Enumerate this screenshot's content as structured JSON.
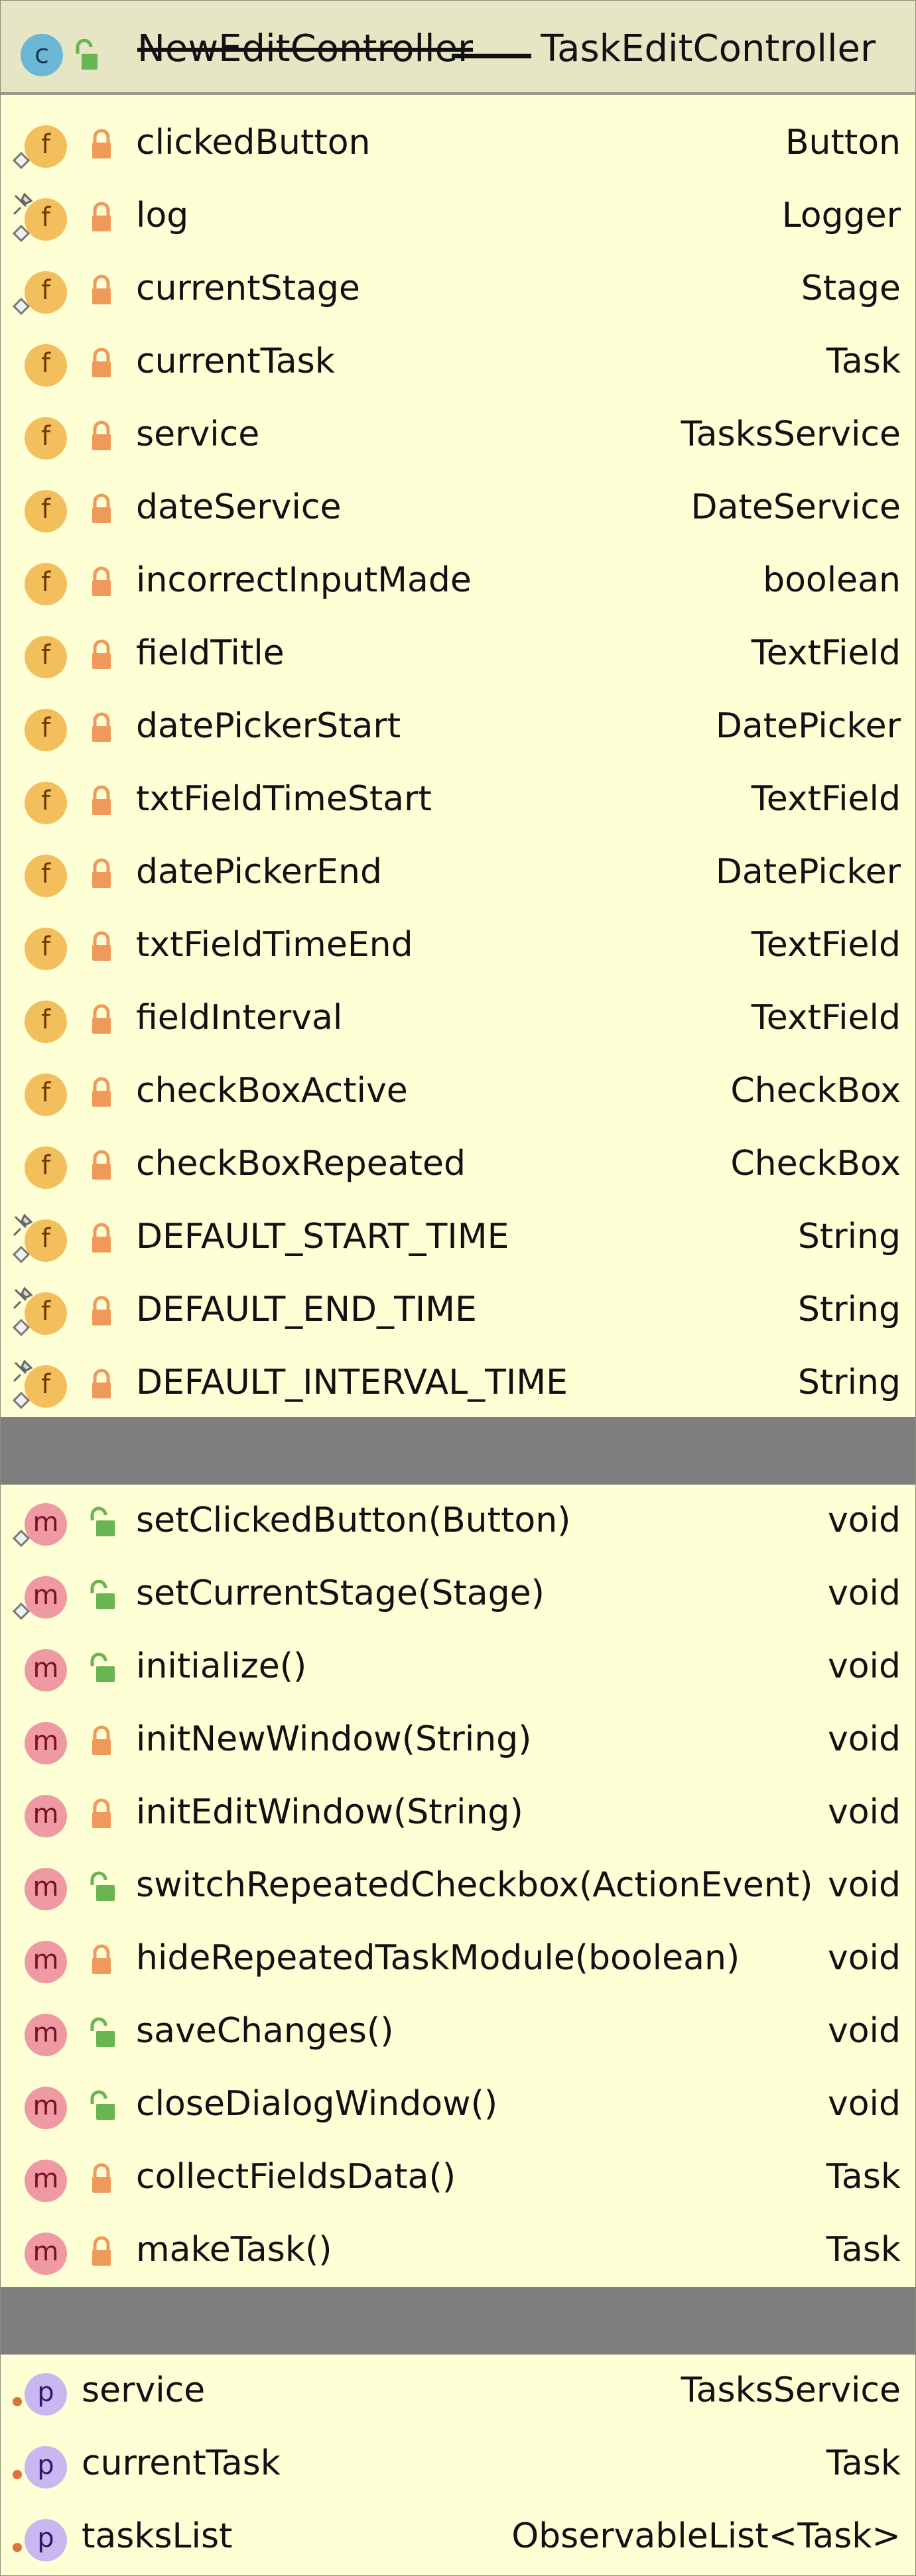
{
  "header": {
    "old_name": "NewEditController",
    "class_name": "TaskEditController",
    "class_icon_letter": "c",
    "icon_color": "#6ab7d6"
  },
  "fields": [
    {
      "name": "clickedButton",
      "type": "Button",
      "icon": "field-icon",
      "lock": "locked",
      "marker": "diamond"
    },
    {
      "name": "log",
      "type": "Logger",
      "icon": "field-icon",
      "lock": "locked",
      "marker": "pin-diamond"
    },
    {
      "name": "currentStage",
      "type": "Stage",
      "icon": "field-icon",
      "lock": "locked",
      "marker": "diamond"
    },
    {
      "name": "currentTask",
      "type": "Task",
      "icon": "field-icon",
      "lock": "locked",
      "marker": ""
    },
    {
      "name": "service",
      "type": "TasksService",
      "icon": "field-icon",
      "lock": "locked",
      "marker": ""
    },
    {
      "name": "dateService",
      "type": "DateService",
      "icon": "field-icon",
      "lock": "locked",
      "marker": ""
    },
    {
      "name": "incorrectInputMade",
      "type": "boolean",
      "icon": "field-icon",
      "lock": "locked",
      "marker": ""
    },
    {
      "name": "fieldTitle",
      "type": "TextField",
      "icon": "field-icon",
      "lock": "locked",
      "marker": ""
    },
    {
      "name": "datePickerStart",
      "type": "DatePicker",
      "icon": "field-icon",
      "lock": "locked",
      "marker": ""
    },
    {
      "name": "txtFieldTimeStart",
      "type": "TextField",
      "icon": "field-icon",
      "lock": "locked",
      "marker": ""
    },
    {
      "name": "datePickerEnd",
      "type": "DatePicker",
      "icon": "field-icon",
      "lock": "locked",
      "marker": ""
    },
    {
      "name": "txtFieldTimeEnd",
      "type": "TextField",
      "icon": "field-icon",
      "lock": "locked",
      "marker": ""
    },
    {
      "name": "fieldInterval",
      "type": "TextField",
      "icon": "field-icon",
      "lock": "locked",
      "marker": ""
    },
    {
      "name": "checkBoxActive",
      "type": "CheckBox",
      "icon": "field-icon",
      "lock": "locked",
      "marker": ""
    },
    {
      "name": "checkBoxRepeated",
      "type": "CheckBox",
      "icon": "field-icon",
      "lock": "locked",
      "marker": ""
    },
    {
      "name": "DEFAULT_START_TIME",
      "type": "String",
      "icon": "field-icon",
      "lock": "locked",
      "marker": "pin-diamond"
    },
    {
      "name": "DEFAULT_END_TIME",
      "type": "String",
      "icon": "field-icon",
      "lock": "locked",
      "marker": "pin-diamond"
    },
    {
      "name": "DEFAULT_INTERVAL_TIME",
      "type": "String",
      "icon": "field-icon",
      "lock": "locked",
      "marker": "pin-diamond"
    }
  ],
  "methods": [
    {
      "name": "setClickedButton(Button)",
      "type": "void",
      "lock": "unlocked",
      "marker": "diamond"
    },
    {
      "name": "setCurrentStage(Stage)",
      "type": "void",
      "lock": "unlocked",
      "marker": "diamond"
    },
    {
      "name": "initialize()",
      "type": "void",
      "lock": "unlocked",
      "marker": ""
    },
    {
      "name": "initNewWindow(String)",
      "type": "void",
      "lock": "locked",
      "marker": ""
    },
    {
      "name": "initEditWindow(String)",
      "type": "void",
      "lock": "locked",
      "marker": ""
    },
    {
      "name": "switchRepeatedCheckbox(ActionEvent)",
      "type": "void",
      "lock": "unlocked",
      "marker": ""
    },
    {
      "name": "hideRepeatedTaskModule(boolean)",
      "type": "void",
      "lock": "locked",
      "marker": ""
    },
    {
      "name": "saveChanges()",
      "type": "void",
      "lock": "unlocked",
      "marker": ""
    },
    {
      "name": "closeDialogWindow()",
      "type": "void",
      "lock": "unlocked",
      "marker": ""
    },
    {
      "name": "collectFieldsData()",
      "type": "Task",
      "lock": "locked",
      "marker": ""
    },
    {
      "name": "makeTask()",
      "type": "Task",
      "lock": "locked",
      "marker": ""
    }
  ],
  "properties": [
    {
      "name": "service",
      "type": "TasksService"
    },
    {
      "name": "currentTask",
      "type": "Task"
    },
    {
      "name": "tasksList",
      "type": "ObservableList<Task>"
    }
  ],
  "icons": {
    "field_letter": "f",
    "method_letter": "m",
    "property_letter": "p"
  },
  "colors": {
    "lock_locked": "#ef9a5a",
    "lock_unlocked": "#69b552",
    "divider": "#7e7e7e"
  }
}
